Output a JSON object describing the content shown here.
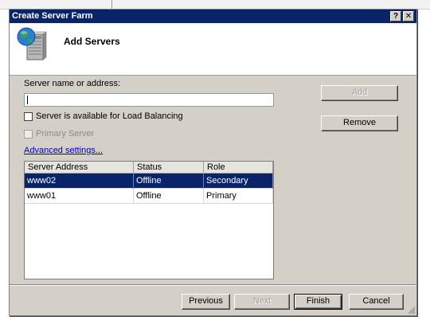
{
  "dialog": {
    "title": "Create Server Farm",
    "help_label": "?",
    "close_label": "✕"
  },
  "header": {
    "heading": "Add Servers"
  },
  "form": {
    "server_label": "Server name or address:",
    "server_value": "",
    "load_balancing_label": "Server is available for Load Balancing",
    "load_balancing_checked": false,
    "primary_label": "Primary Server",
    "primary_checked": false,
    "advanced_link": "Advanced settings..."
  },
  "table": {
    "columns": [
      "Server Address",
      "Status",
      "Role"
    ],
    "rows": [
      {
        "address": "www02",
        "status": "Offline",
        "role": "Secondary",
        "selected": true
      },
      {
        "address": "www01",
        "status": "Offline",
        "role": "Primary",
        "selected": false
      }
    ]
  },
  "buttons": {
    "add": "Add",
    "remove": "Remove",
    "previous": "Previous",
    "next": "Next",
    "finish": "Finish",
    "cancel": "Cancel"
  },
  "colors": {
    "titlebar": "#0a246a",
    "selection": "#0a246a",
    "link": "#0000cc",
    "dialog_bg": "#d4d0c8"
  },
  "icons": {
    "header_icon": "server-globe-icon"
  }
}
